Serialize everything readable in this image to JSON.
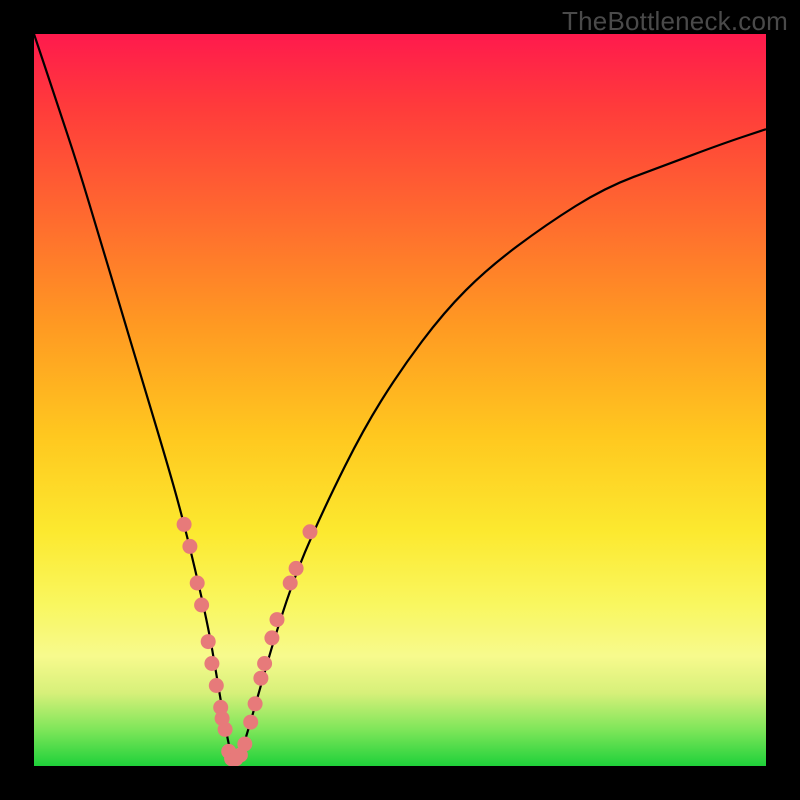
{
  "watermark": "TheBottleneck.com",
  "colors": {
    "dot": "#e77a7a",
    "curve": "#000000",
    "frame": "#000000"
  },
  "chart_data": {
    "type": "line",
    "title": "",
    "xlabel": "",
    "ylabel": "",
    "xlim": [
      0,
      100
    ],
    "ylim": [
      0,
      100
    ],
    "note": "Axes are unmarked in the image; x and y are normalized 0–100. y≈0 is the green band (bottom), y≈100 is the red top. The curve is a V/U shape with minimum near x≈27.",
    "series": [
      {
        "name": "bottleneck-curve",
        "x": [
          0,
          3,
          6,
          9,
          12,
          15,
          18,
          20,
          22,
          24,
          25,
          26,
          27,
          28,
          29,
          31,
          33,
          36,
          40,
          45,
          50,
          56,
          62,
          70,
          78,
          86,
          94,
          100
        ],
        "y": [
          100,
          91,
          82,
          72,
          62,
          52,
          42,
          35,
          27,
          18,
          12,
          6,
          1,
          1,
          4,
          11,
          18,
          27,
          36,
          46,
          54,
          62,
          68,
          74,
          79,
          82,
          85,
          87
        ]
      }
    ],
    "scatter": [
      {
        "name": "left-branch-markers",
        "points": [
          {
            "x": 20.5,
            "y": 33
          },
          {
            "x": 21.3,
            "y": 30
          },
          {
            "x": 22.3,
            "y": 25
          },
          {
            "x": 22.9,
            "y": 22
          },
          {
            "x": 23.8,
            "y": 17
          },
          {
            "x": 24.3,
            "y": 14
          },
          {
            "x": 24.9,
            "y": 11
          },
          {
            "x": 25.5,
            "y": 8
          },
          {
            "x": 25.7,
            "y": 6.5
          },
          {
            "x": 26.1,
            "y": 5
          }
        ]
      },
      {
        "name": "valley-markers",
        "points": [
          {
            "x": 26.6,
            "y": 2
          },
          {
            "x": 27.0,
            "y": 1
          },
          {
            "x": 27.6,
            "y": 1
          },
          {
            "x": 28.2,
            "y": 1.5
          },
          {
            "x": 28.8,
            "y": 3
          }
        ]
      },
      {
        "name": "right-branch-markers",
        "points": [
          {
            "x": 29.6,
            "y": 6
          },
          {
            "x": 30.2,
            "y": 8.5
          },
          {
            "x": 31.0,
            "y": 12
          },
          {
            "x": 31.5,
            "y": 14
          },
          {
            "x": 32.5,
            "y": 17.5
          },
          {
            "x": 33.2,
            "y": 20
          },
          {
            "x": 35.0,
            "y": 25
          },
          {
            "x": 35.8,
            "y": 27
          },
          {
            "x": 37.7,
            "y": 32
          }
        ]
      }
    ]
  }
}
